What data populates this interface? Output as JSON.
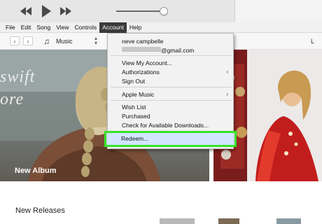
{
  "menubar": {
    "items": [
      "File",
      "Edit",
      "Song",
      "View",
      "Controls",
      "Account",
      "Help"
    ]
  },
  "navbar": {
    "media_kind": "Music",
    "right_letter": "L"
  },
  "banner_left": {
    "art_text_line1": "swift",
    "art_text_line2": "ore",
    "caption": "New Album"
  },
  "section_title": "New Releases",
  "account_menu": {
    "user_name": "neve campbelle",
    "email_suffix": "@gmail.com",
    "view_account": "View My Account...",
    "authorizations": "Authorizations",
    "sign_out": "Sign Out",
    "apple_music": "Apple Music",
    "wish_list": "Wish List",
    "purchased": "Purchased",
    "check_downloads": "Check for Available Downloads...",
    "redeem": "Redeem..."
  },
  "colors": {
    "highlight_border": "#39e22a",
    "menu_active_bg": "#3a3a3a"
  }
}
